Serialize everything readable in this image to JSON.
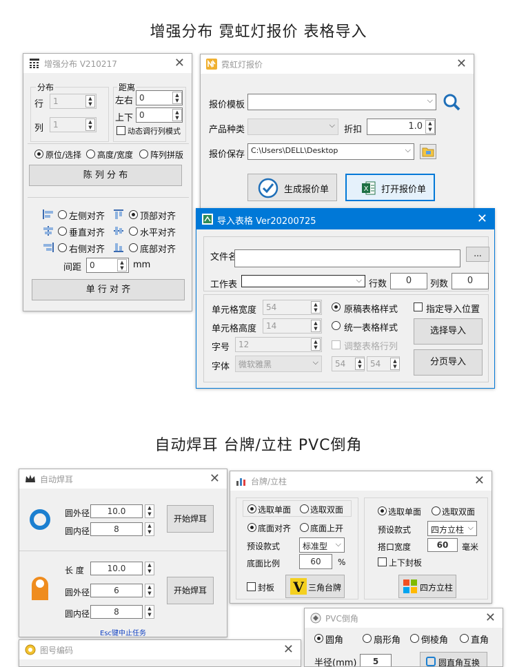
{
  "headings": {
    "top": "增强分布 霓虹灯报价 表格导入",
    "bottom": "自动焊耳 台牌/立柱 PVC倒角"
  },
  "win_distribute": {
    "title": "增强分布 V210217",
    "group_dist": "分布",
    "row_label": "行",
    "row_value": "1",
    "col_label": "列",
    "col_value": "1",
    "group_spacing": "距离",
    "lr_label": "左右",
    "lr_value": "0",
    "ud_label": "上下",
    "ud_value": "0",
    "dynamic_label": "动态调行列模式",
    "radio1": "原位/选择",
    "radio2": "高度/宽度",
    "radio3": "阵列拼版",
    "btn_distribute": "陈 列 分 布",
    "align_left": "左侧对齐",
    "align_top": "顶部对齐",
    "align_vcenter": "垂直对齐",
    "align_hcenter": "水平对齐",
    "align_right": "右侧对齐",
    "align_bottom": "底部对齐",
    "gap_label": "间距",
    "gap_value": "0",
    "gap_unit": "mm",
    "btn_align": "单 行 对 齐"
  },
  "win_neon": {
    "title": "霓虹灯报价",
    "template_label": "报价模板",
    "template_value": "",
    "category_label": "产品种类",
    "discount_label": "折扣",
    "discount_value": "1.0",
    "save_label": "报价保存",
    "save_value": "C:\\Users\\DELL\\Desktop",
    "btn_generate": "生成报价单",
    "btn_open": "打开报价单"
  },
  "win_import": {
    "title": "导入表格 Ver20200725",
    "file_label": "文件名",
    "browse": "...",
    "sheet_label": "工作表",
    "rows_label": "行数",
    "rows_value": "0",
    "cols_label": "列数",
    "cols_value": "0",
    "cellw_label": "单元格宽度",
    "cellw_value": "54",
    "cellh_label": "单元格高度",
    "cellh_value": "14",
    "fontsize_label": "字号",
    "fontsize_value": "12",
    "font_label": "字体",
    "font_value": "微软雅黑",
    "style_orig": "原稿表格样式",
    "style_unified": "统一表格样式",
    "adjust_rows": "调整表格行列",
    "w2": "54",
    "h2": "54",
    "specify_pos": "指定导入位置",
    "btn_select": "选择导入",
    "btn_paged": "分页导入"
  },
  "win_weld": {
    "title": "自动焊耳",
    "outer_label": "圆外径",
    "outer_value": "10.0",
    "inner_label": "圆内径",
    "inner_value": "8",
    "btn_start1": "开始焊耳",
    "len_label": "长  度",
    "len_value": "10.0",
    "outer2_label": "圆外径",
    "outer2_value": "6",
    "inner2_label": "圆内径",
    "inner2_value": "8",
    "btn_start2": "开始焊耳",
    "esc_hint": "Esc键中止任务"
  },
  "win_number": {
    "title": "图号编码"
  },
  "win_sign": {
    "title": "台牌/立柱",
    "single": "选取单面",
    "double": "选取双面",
    "bottom_align": "底面对齐",
    "bottom_up": "底面上开",
    "preset_label": "预设款式",
    "preset_value": "标准型",
    "ratio_label": "底面比例",
    "ratio_value": "60",
    "ratio_unit": "%",
    "cover": "封板",
    "btn_triangle": "三角台牌",
    "single2": "选取单面",
    "double2": "选取双面",
    "preset2_label": "预设款式",
    "preset2_value": "四方立柱",
    "width_label": "搭口宽度",
    "width_value": "60",
    "width_unit": "毫米",
    "updown": "上下封板",
    "btn_square": "四方立柱"
  },
  "win_pvc": {
    "title": "PVC倒角",
    "r1": "圆角",
    "r2": "扇形角",
    "r3": "倒棱角",
    "r4": "直角",
    "radius_label": "半径(mm)",
    "radius_value": "5",
    "btn_swap": "圆直角互换"
  }
}
